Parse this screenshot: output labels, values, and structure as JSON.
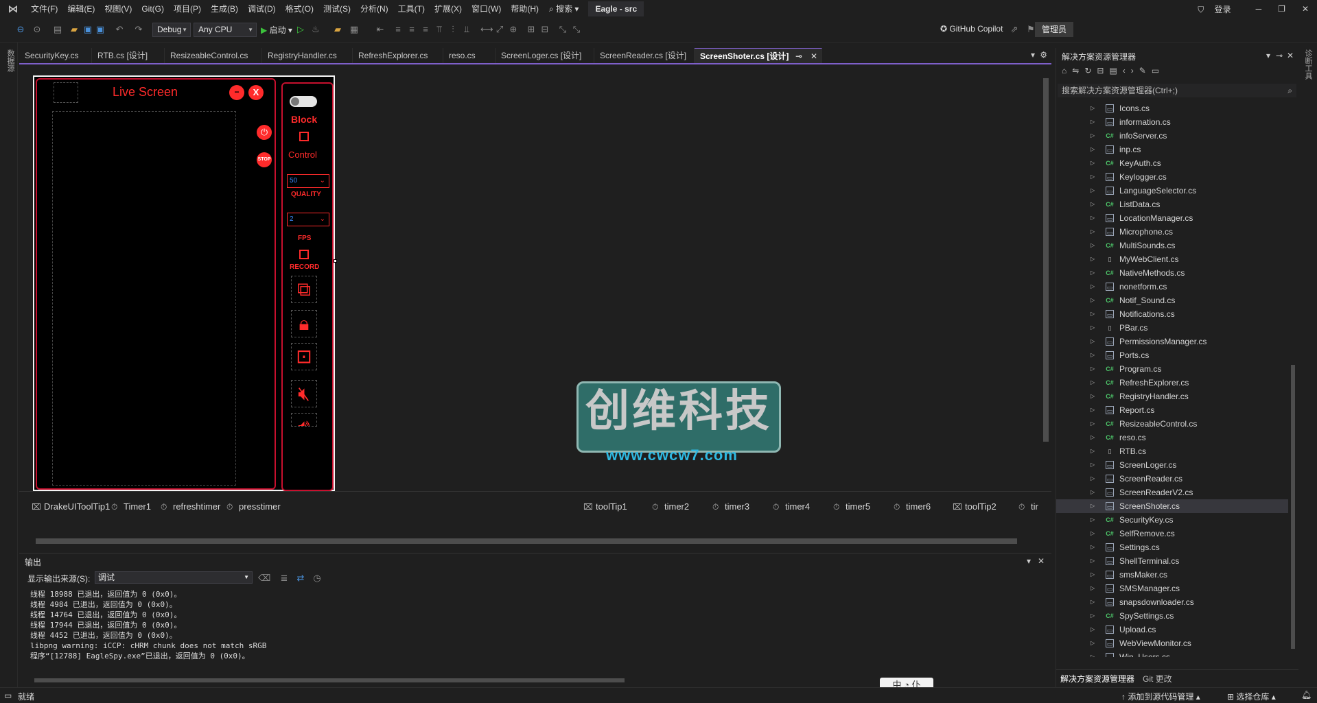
{
  "menubar": {
    "items": [
      "文件(F)",
      "编辑(E)",
      "视图(V)",
      "Git(G)",
      "项目(P)",
      "生成(B)",
      "调试(D)",
      "格式(O)",
      "测试(S)",
      "分析(N)",
      "工具(T)",
      "扩展(X)",
      "窗口(W)",
      "帮助(H)"
    ],
    "search": "搜索",
    "solution": "Eagle - src",
    "login": "登录"
  },
  "toolbar": {
    "config": "Debug",
    "platform": "Any CPU",
    "start": "启动",
    "copilot": "GitHub Copilot",
    "admin": "管理员"
  },
  "left_strip": "数据源",
  "right_strip": "诊断工具",
  "tabs": [
    {
      "label": "SecurityKey.cs"
    },
    {
      "label": "RTB.cs [设计]"
    },
    {
      "label": "ResizeableControl.cs"
    },
    {
      "label": "RegistryHandler.cs"
    },
    {
      "label": "RefreshExplorer.cs"
    },
    {
      "label": "reso.cs"
    },
    {
      "label": "ScreenLoger.cs [设计]"
    },
    {
      "label": "ScreenReader.cs [设计]"
    },
    {
      "label": "ScreenShoter.cs [设计]"
    }
  ],
  "form": {
    "title": "Live Screen",
    "block": "Block",
    "control": "Control",
    "quality_value": "50",
    "quality": "QUALITY",
    "fps_value": "2",
    "fps": "FPS",
    "record": "RECORD",
    "stop": "STOP",
    "minimize": "−",
    "close": "X"
  },
  "tray": {
    "row1": [
      "DrakeUIToolTip1",
      "Timer1",
      "refreshtimer",
      "presstimer"
    ],
    "row1b": [
      "toolTip1",
      "timer2",
      "timer3",
      "timer4",
      "timer5",
      "timer6",
      "toolTip2",
      "tir"
    ]
  },
  "output": {
    "title": "输出",
    "source_label": "显示输出来源(S):",
    "source_value": "调试",
    "lines": [
      "线程 18988 已退出，返回值为 0 (0x0)。",
      "线程 4984 已退出，返回值为 0 (0x0)。",
      "线程 14764 已退出，返回值为 0 (0x0)。",
      "线程 17944 已退出，返回值为 0 (0x0)。",
      "线程 4452 已退出，返回值为 0 (0x0)。",
      "libpng warning: iCCP: cHRM chunk does not match sRGB",
      "程序“[12788] EagleSpy.exe”已退出，返回值为 0 (0x0)。"
    ]
  },
  "solution_explorer": {
    "title": "解决方案资源管理器",
    "search_placeholder": "搜索解决方案资源管理器(Ctrl+;)",
    "files": [
      {
        "name": "Icons.cs",
        "icon": "form"
      },
      {
        "name": "information.cs",
        "icon": "form"
      },
      {
        "name": "infoServer.cs",
        "icon": "cs"
      },
      {
        "name": "inp.cs",
        "icon": "form"
      },
      {
        "name": "KeyAuth.cs",
        "icon": "cs"
      },
      {
        "name": "Keylogger.cs",
        "icon": "form"
      },
      {
        "name": "LanguageSelector.cs",
        "icon": "form"
      },
      {
        "name": "ListData.cs",
        "icon": "cs"
      },
      {
        "name": "LocationManager.cs",
        "icon": "form"
      },
      {
        "name": "Microphone.cs",
        "icon": "form"
      },
      {
        "name": "MultiSounds.cs",
        "icon": "cs"
      },
      {
        "name": "MyWebClient.cs",
        "icon": "doc"
      },
      {
        "name": "NativeMethods.cs",
        "icon": "cs"
      },
      {
        "name": "nonetform.cs",
        "icon": "form"
      },
      {
        "name": "Notif_Sound.cs",
        "icon": "cs"
      },
      {
        "name": "Notifications.cs",
        "icon": "form"
      },
      {
        "name": "PBar.cs",
        "icon": "doc"
      },
      {
        "name": "PermissionsManager.cs",
        "icon": "form"
      },
      {
        "name": "Ports.cs",
        "icon": "form"
      },
      {
        "name": "Program.cs",
        "icon": "cs"
      },
      {
        "name": "RefreshExplorer.cs",
        "icon": "cs"
      },
      {
        "name": "RegistryHandler.cs",
        "icon": "cs"
      },
      {
        "name": "Report.cs",
        "icon": "form"
      },
      {
        "name": "ResizeableControl.cs",
        "icon": "cs"
      },
      {
        "name": "reso.cs",
        "icon": "cs"
      },
      {
        "name": "RTB.cs",
        "icon": "doc"
      },
      {
        "name": "ScreenLoger.cs",
        "icon": "form"
      },
      {
        "name": "ScreenReader.cs",
        "icon": "form"
      },
      {
        "name": "ScreenReaderV2.cs",
        "icon": "form"
      },
      {
        "name": "ScreenShoter.cs",
        "icon": "form",
        "selected": true
      },
      {
        "name": "SecurityKey.cs",
        "icon": "cs"
      },
      {
        "name": "SelfRemove.cs",
        "icon": "cs"
      },
      {
        "name": "Settings.cs",
        "icon": "form"
      },
      {
        "name": "ShellTerminal.cs",
        "icon": "form"
      },
      {
        "name": "smsMaker.cs",
        "icon": "form"
      },
      {
        "name": "SMSManager.cs",
        "icon": "form"
      },
      {
        "name": "snapsdownloader.cs",
        "icon": "form"
      },
      {
        "name": "SpySettings.cs",
        "icon": "cs"
      },
      {
        "name": "Upload.cs",
        "icon": "form"
      },
      {
        "name": "WebViewMonitor.cs",
        "icon": "form"
      },
      {
        "name": "Win_Users.cs",
        "icon": "form"
      }
    ],
    "bottom_tabs": [
      "解决方案资源管理器",
      "Git 更改"
    ]
  },
  "status": {
    "ready": "就绪",
    "add_source": "添加到源代码管理",
    "select_repo": "选择仓库"
  },
  "ime": "中 ◔ 仆",
  "watermark": {
    "text": "创维科技",
    "url": "www.cwcw7.com"
  }
}
